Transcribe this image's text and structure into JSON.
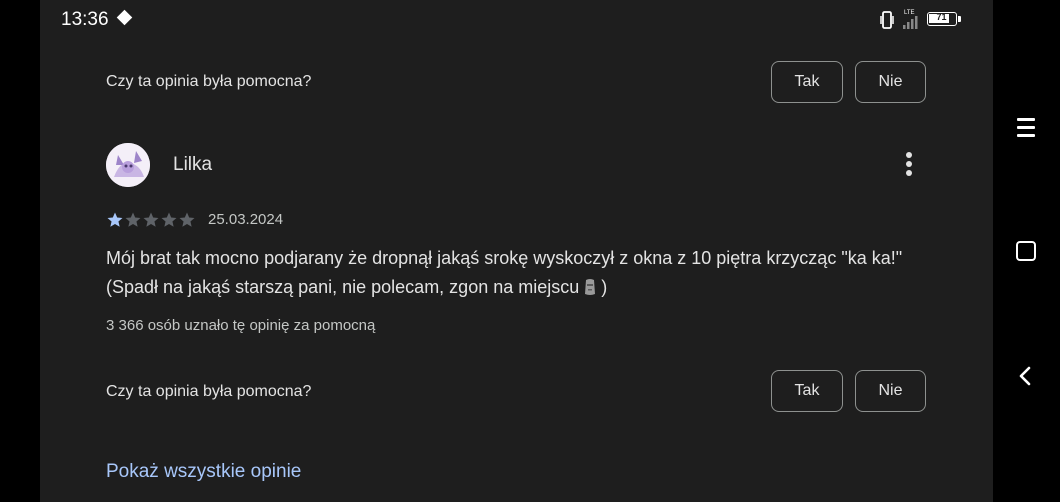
{
  "status_bar": {
    "time": "13:36",
    "network": "LTE",
    "battery": "71"
  },
  "top_feedback": {
    "question": "Czy ta opinia była pomocna?",
    "yes_label": "Tak",
    "no_label": "Nie"
  },
  "review": {
    "author": "Lilka",
    "rating": 1,
    "max_rating": 5,
    "date": "25.03.2024",
    "text_before_emoji": "Mój brat tak mocno podjarany że dropnął jakąś srokę wyskoczył z okna z 10 piętra krzycząc \"ka ka!\" (Spadł na jakąś starszą pani, nie polecam, zgon na miejscu",
    "emoji": "moai-emoji",
    "text_after_emoji": ")",
    "helpful_count_text": "3 366 osób uznało tę opinię za pomocną",
    "feedback": {
      "question": "Czy ta opinia była pomocna?",
      "yes_label": "Tak",
      "no_label": "Nie"
    }
  },
  "show_all_label": "Pokaż wszystkie opinie",
  "colors": {
    "background": "#1e1e1e",
    "text": "#e3e3e3",
    "star_filled": "#a8c7fa",
    "star_empty": "#5f6368",
    "link": "#a8c7fa"
  },
  "nav_icons": [
    "menu-icon",
    "home-icon",
    "back-icon"
  ]
}
